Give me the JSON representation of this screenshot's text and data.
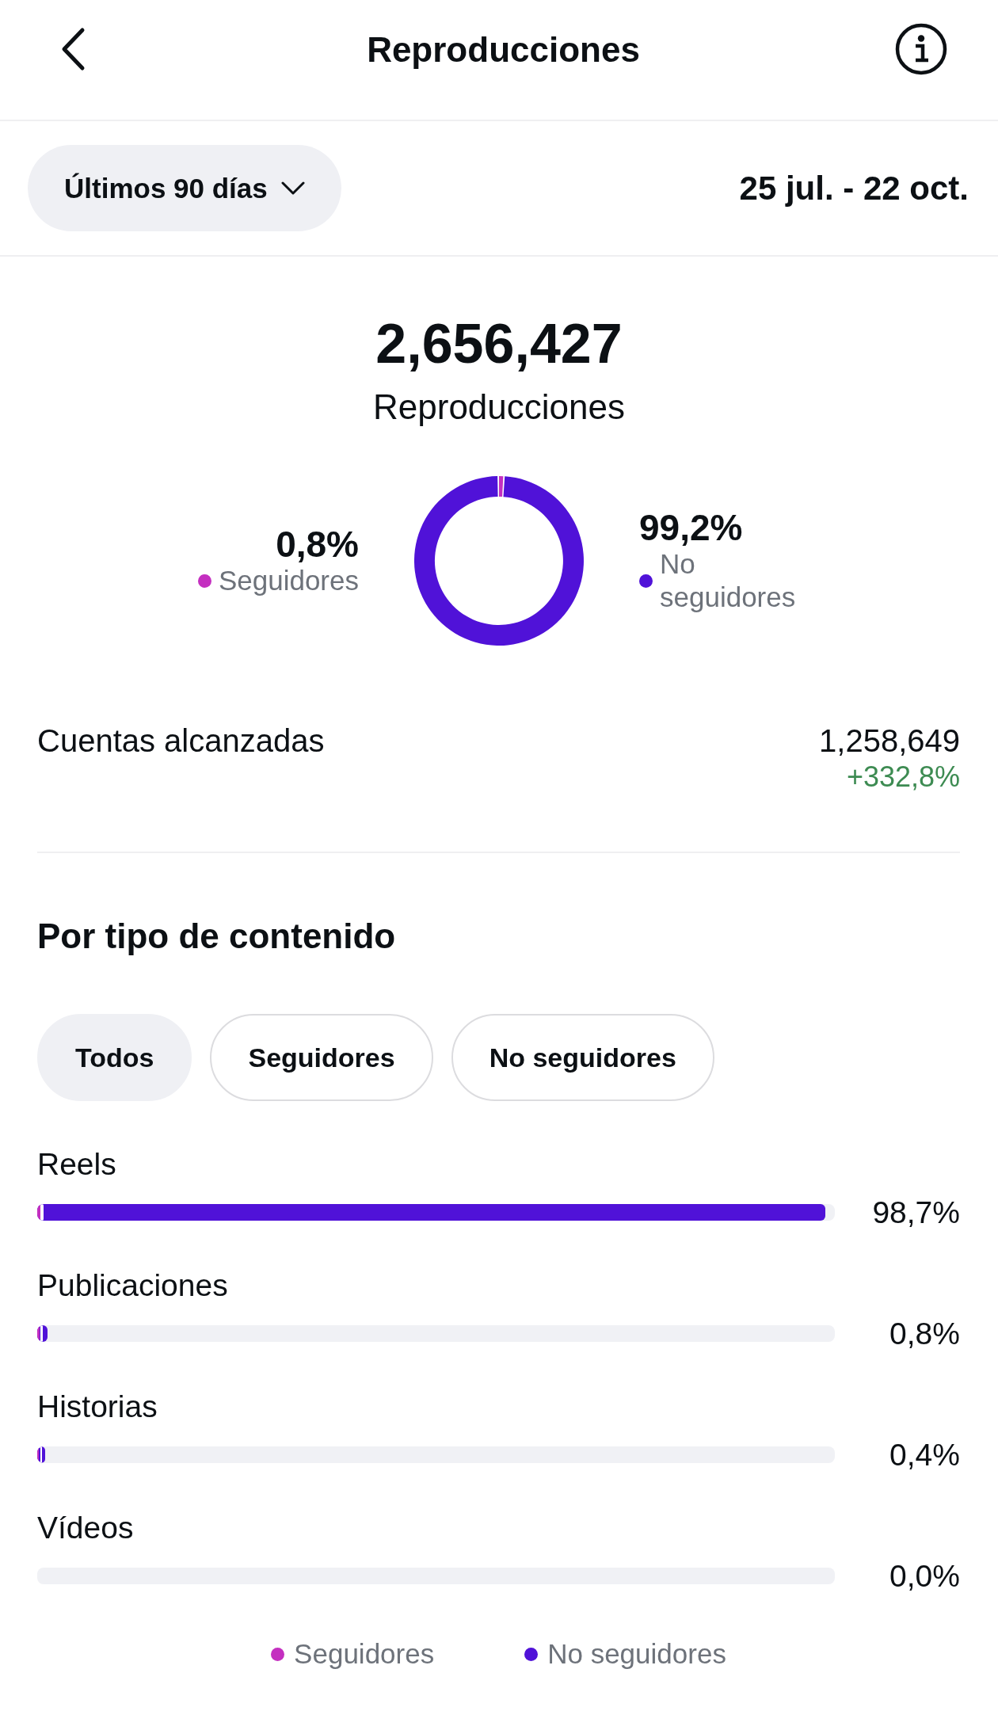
{
  "header": {
    "title": "Reproducciones"
  },
  "period": {
    "label": "Últimos 90 días",
    "range": "25 jul. - 22 oct."
  },
  "summary": {
    "value": "2,656,427",
    "label": "Reproducciones",
    "chart_data": {
      "type": "donut",
      "categories": [
        "Seguidores",
        "No seguidores"
      ],
      "values": [
        0.8,
        99.2
      ],
      "value_labels": [
        "0,8%",
        "99,2%"
      ],
      "colors": [
        "#c42fc0",
        "#5012d8"
      ],
      "legend": "bottom left"
    }
  },
  "reach": {
    "label": "Cuentas alcanzadas",
    "value": "1,258,649",
    "change": "+332,8%",
    "positive": true
  },
  "content_types": {
    "title": "Por tipo de contenido",
    "tabs": [
      {
        "label": "Todos",
        "selected": true
      },
      {
        "label": "Seguidores",
        "selected": false
      },
      {
        "label": "No seguidores",
        "selected": false
      }
    ],
    "rows": [
      {
        "label": "Reels",
        "percent": "98,7%",
        "segments": [
          {
            "color": "#c42fc0",
            "level": 0.004
          },
          {
            "color": "#5012d8",
            "level": 0.988
          }
        ]
      },
      {
        "label": "Publicaciones",
        "percent": "0,8%",
        "segments": [
          {
            "color": "#c42fc0",
            "level": 0.003
          },
          {
            "color": "#5012d8",
            "level": 0.013
          }
        ]
      },
      {
        "label": "Historias",
        "percent": "0,4%",
        "segments": [
          {
            "color": "#c42fc0",
            "level": 0.002
          },
          {
            "color": "#5012d8",
            "level": 0.01
          }
        ]
      },
      {
        "label": "Vídeos",
        "percent": "0,0%"
      }
    ],
    "legend": [
      {
        "label": "Seguidores",
        "color": "#c42fc0"
      },
      {
        "label": "No seguidores",
        "color": "#5012d8"
      }
    ]
  }
}
